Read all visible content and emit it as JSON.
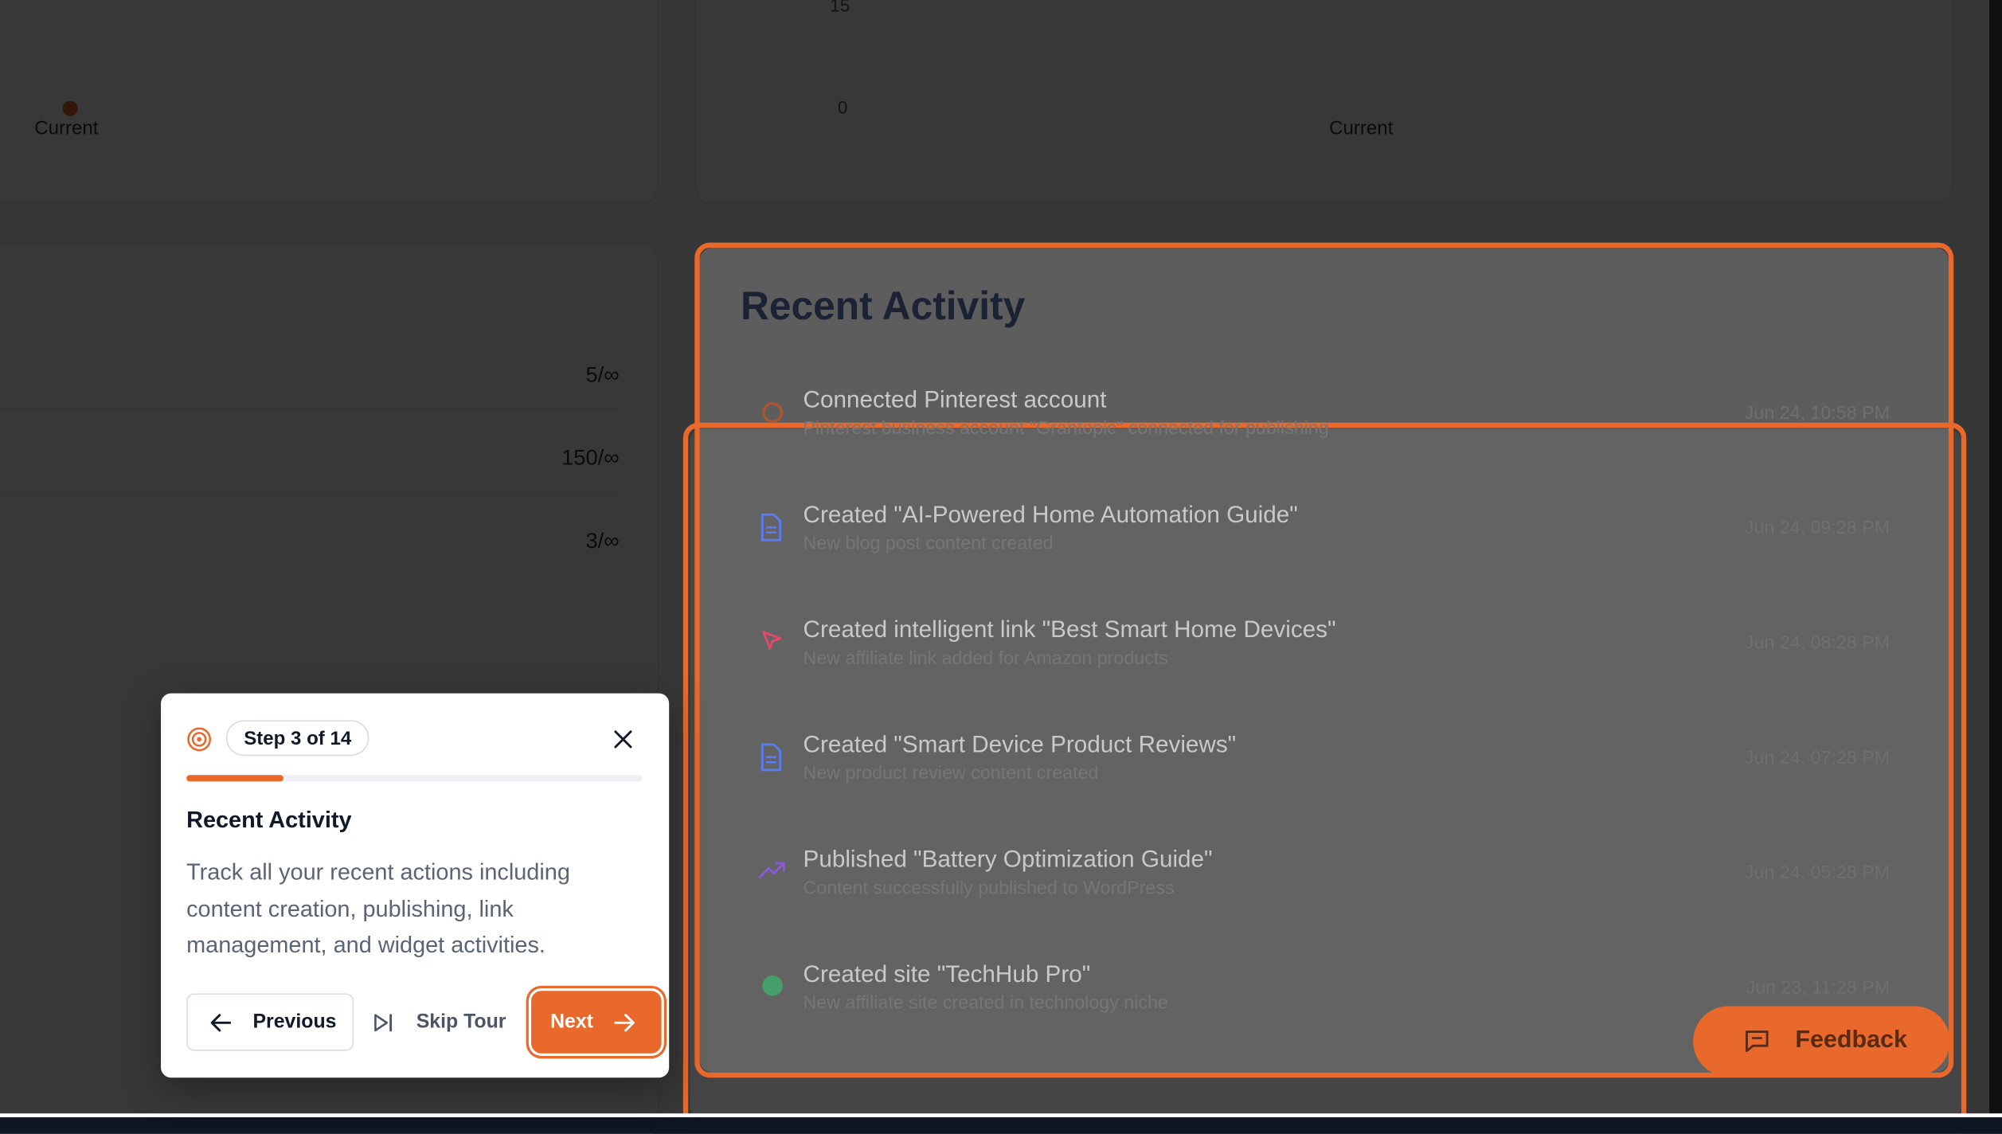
{
  "charts_strip": {
    "left_label": "Current",
    "right_tick_top": "15",
    "right_tick_zero": "0",
    "right_label": "Current"
  },
  "usage": {
    "rows": [
      {
        "value": "5/∞"
      },
      {
        "value": "150/∞"
      },
      {
        "value": "3/∞"
      }
    ]
  },
  "recent_activity": {
    "title": "Recent Activity",
    "items": [
      {
        "title": "Connected Pinterest account",
        "subtitle": "Pinterest business account \"Grantopic\" connected for publishing",
        "time": "Jun 24, 10:58 PM",
        "icon": "pinterest-icon",
        "color": "#e8692b"
      },
      {
        "title": "Created \"AI-Powered Home Automation Guide\"",
        "subtitle": "New blog post content created",
        "time": "Jun 24, 09:28 PM",
        "icon": "document-icon",
        "color": "#5b7cf0"
      },
      {
        "title": "Created intelligent link \"Best Smart Home Devices\"",
        "subtitle": "New affiliate link added for Amazon products",
        "time": "Jun 24, 08:28 PM",
        "icon": "cursor-icon",
        "color": "#e04a6a"
      },
      {
        "title": "Created \"Smart Device Product Reviews\"",
        "subtitle": "New product review content created",
        "time": "Jun 24, 07:28 PM",
        "icon": "document-icon",
        "color": "#5b7cf0"
      },
      {
        "title": "Published \"Battery Optimization Guide\"",
        "subtitle": "Content successfully published to WordPress",
        "time": "Jun 24, 05:28 PM",
        "icon": "trending-up-icon",
        "color": "#8a5ad8"
      },
      {
        "title": "Created site \"TechHub Pro\"",
        "subtitle": "New affiliate site created in technology niche",
        "time": "Jun 23, 11:28 PM",
        "icon": "globe-icon",
        "color": "#3fae6b"
      }
    ]
  },
  "tour": {
    "step_label": "Step 3 of 14",
    "progress": 0.214,
    "title": "Recent Activity",
    "body": "Track all your recent actions including content creation, publishing, link management, and widget activities.",
    "previous_label": "Previous",
    "skip_label": "Skip Tour",
    "next_label": "Next"
  },
  "feedback": {
    "label": "Feedback"
  },
  "colors": {
    "accent": "#e8692b",
    "overlay": "rgba(0,0,0,0.78)"
  }
}
